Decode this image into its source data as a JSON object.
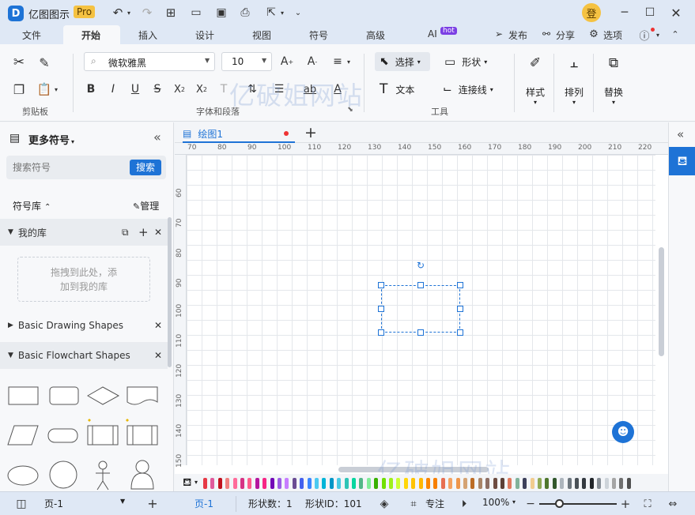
{
  "app": {
    "name": "亿图图示",
    "edition": "Pro",
    "user_initial": "登"
  },
  "menu": {
    "tabs": [
      "文件",
      "开始",
      "插入",
      "设计",
      "视图",
      "符号",
      "高级",
      "AI"
    ],
    "active": "开始",
    "ai_badge": "hot",
    "right": [
      "发布",
      "分享",
      "选项"
    ]
  },
  "ribbon": {
    "font_name": "微软雅黑",
    "font_size": "10",
    "select_label": "选择",
    "shape_label": "形状",
    "text_label": "文本",
    "connector_label": "连接线",
    "style_label": "样式",
    "arrange_label": "排列",
    "replace_label": "替换",
    "groups": {
      "clipboard": "剪贴板",
      "font": "字体和段落",
      "tools": "工具"
    }
  },
  "watermark": "亿破姐网站",
  "left": {
    "title": "更多符号",
    "search_placeholder": "搜索符号",
    "search_btn": "搜索",
    "lib_label": "符号库",
    "manage": "管理",
    "my_lib": "我的库",
    "drop_hint_1": "拖拽到此处，添",
    "drop_hint_2": "加到我的库",
    "libs": [
      "Basic Drawing Shapes",
      "Basic Flowchart Shapes"
    ]
  },
  "doc": {
    "tab": "绘图1"
  },
  "ruler": {
    "h": [
      "70",
      "80",
      "90",
      "100",
      "110",
      "120",
      "130",
      "140",
      "150",
      "160",
      "170",
      "180",
      "190",
      "200",
      "210",
      "220"
    ],
    "v": [
      "60",
      "70",
      "80",
      "90",
      "100",
      "110",
      "120",
      "130",
      "140",
      "150"
    ]
  },
  "status": {
    "page_select": "页-1",
    "page_tab": "页-1",
    "shape_count": "形状数：1",
    "shape_id": "形状ID：101",
    "focus": "专注",
    "zoom": "100%"
  },
  "colors": {
    "accent": "#1e73d6",
    "pro": "#f5c242"
  }
}
